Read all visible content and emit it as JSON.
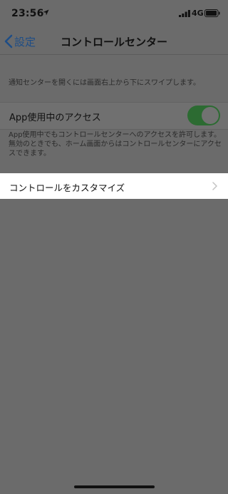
{
  "status_bar": {
    "time": "23:56",
    "network": "4G"
  },
  "nav": {
    "back_label": "設定",
    "title": "コントロールセンター"
  },
  "captions": {
    "top": "通知センターを開くには画面右上から下にスワイプします。",
    "access_description": "App使用中でもコントロールセンターへのアクセスを許可します。無効のときでも、ホーム画面からはコントロールセンターにアクセスできます。"
  },
  "access_cell": {
    "label": "App使用中のアクセス",
    "toggle_on": true
  },
  "customize_cell": {
    "label": "コントロールをカスタマイズ"
  },
  "colors": {
    "overlay": "#6b6b6b",
    "accent": "#1e4d86",
    "toggle_on": "#2c6b32"
  }
}
